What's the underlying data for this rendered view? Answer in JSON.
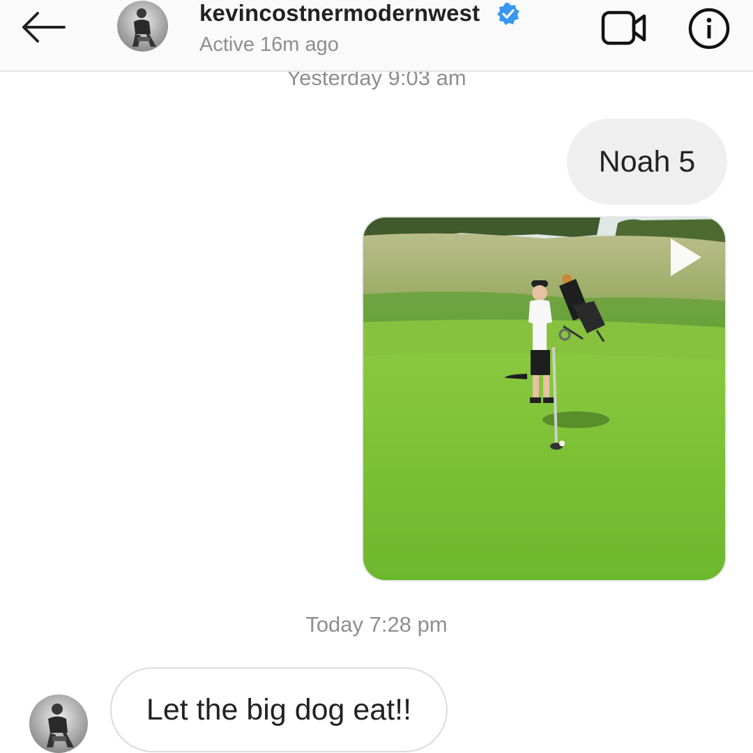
{
  "header": {
    "username": "kevincostnermodernwest",
    "status": "Active 16m ago",
    "verified": true,
    "icons": {
      "back": "back-arrow-icon",
      "video": "video-call-icon",
      "info": "info-icon",
      "verified": "verified-badge-icon"
    }
  },
  "thread": {
    "timestamps": {
      "yesterday": "Yesterday 9:03 am",
      "today": "Today 7:28 pm"
    },
    "messages": [
      {
        "sender": "me",
        "type": "text",
        "text": "Noah 5"
      },
      {
        "sender": "me",
        "type": "video",
        "icon": "play-icon"
      },
      {
        "sender": "them",
        "type": "text",
        "text": "Let the big dog eat!!"
      }
    ]
  },
  "colors": {
    "verified_blue": "#3897f0",
    "sent_bubble": "#efefef",
    "received_border": "#dbdbdb",
    "muted_text": "#8e8e8e"
  }
}
